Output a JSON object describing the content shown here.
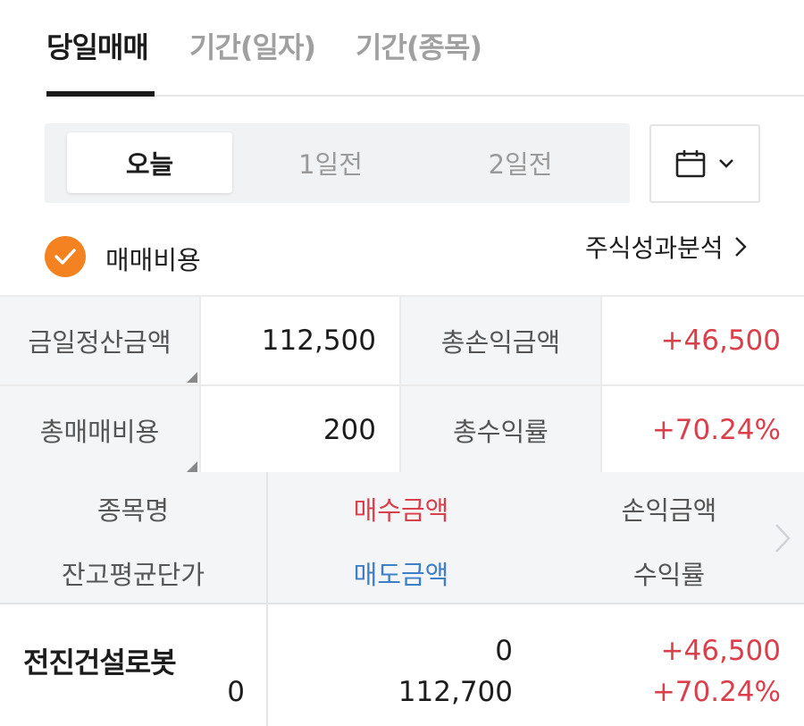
{
  "tabs": [
    {
      "label": "당일매매",
      "active": true
    },
    {
      "label": "기간(일자)",
      "active": false
    },
    {
      "label": "기간(종목)",
      "active": false
    }
  ],
  "day_selector": {
    "options": [
      {
        "label": "오늘",
        "active": true
      },
      {
        "label": "1일전",
        "active": false
      },
      {
        "label": "2일전",
        "active": false
      }
    ],
    "calendar_icon": "calendar-icon",
    "dropdown_icon": "chevron-down-icon"
  },
  "fee_option": {
    "label": "매매비용",
    "checked": true
  },
  "analysis_link": {
    "label": "주식성과분석",
    "icon": "chevron-right-icon"
  },
  "summary": {
    "settlement_label": "금일정산금액",
    "settlement_value": "112,500",
    "total_pl_label": "총손익금액",
    "total_pl_value": "+46,500",
    "total_fee_label": "총매매비용",
    "total_fee_value": "200",
    "total_return_label": "총수익률",
    "total_return_value": "+70.24%"
  },
  "holdings_header": {
    "name": "종목명",
    "avg_price": "잔고평균단가",
    "buy_amount": "매수금액",
    "sell_amount": "매도금액",
    "pl_amount": "손익금액",
    "return_rate": "수익률"
  },
  "holdings": [
    {
      "name": "전진건설로봇",
      "avg_price": "0",
      "buy_amount": "0",
      "sell_amount": "112,700",
      "pl_amount": "+46,500",
      "return_rate": "+70.24%"
    }
  ],
  "colors": {
    "accent_orange": "#f58220",
    "profit_red": "#d9404b",
    "sell_blue": "#3e80c7",
    "label_bg": "#f4f5f7"
  }
}
